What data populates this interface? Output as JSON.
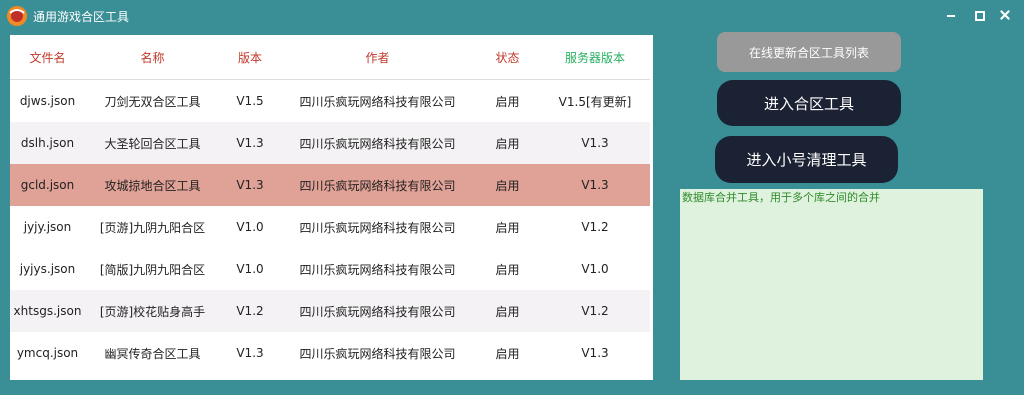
{
  "window": {
    "title": "通用游戏合区工具"
  },
  "table": {
    "headers": [
      "文件名",
      "名称",
      "版本",
      "作者",
      "状态",
      "服务器版本"
    ],
    "rows": [
      [
        "djws.json",
        "刀剑无双合区工具",
        "V1.5",
        "四川乐疯玩网络科技有限公司",
        "启用",
        "V1.5[有更新]"
      ],
      [
        "dslh.json",
        "大圣轮回合区工具",
        "V1.3",
        "四川乐疯玩网络科技有限公司",
        "启用",
        "V1.3"
      ],
      [
        "gcld.json",
        "攻城掠地合区工具",
        "V1.3",
        "四川乐疯玩网络科技有限公司",
        "启用",
        "V1.3"
      ],
      [
        "jyjy.json",
        "[页游]九阴九阳合区",
        "V1.0",
        "四川乐疯玩网络科技有限公司",
        "启用",
        "V1.2"
      ],
      [
        "jyjys.json",
        "[简版]九阴九阳合区",
        "V1.0",
        "四川乐疯玩网络科技有限公司",
        "启用",
        "V1.0"
      ],
      [
        "xhtsgs.json",
        "[页游]校花贴身高手",
        "V1.2",
        "四川乐疯玩网络科技有限公司",
        "启用",
        "V1.2"
      ],
      [
        "ymcq.json",
        "幽冥传奇合区工具",
        "V1.3",
        "四川乐疯玩网络科技有限公司",
        "启用",
        "V1.3"
      ]
    ],
    "selected_row": 2
  },
  "buttons": {
    "update_list": "在线更新合区工具列表",
    "enter_merge": "进入合区工具",
    "enter_cleanup": "进入小号清理工具"
  },
  "description": "数据库合并工具，用于多个库之间的合并",
  "icons": {
    "app_logo": "app-logo-icon",
    "minimize": "minimize-icon",
    "maximize": "maximize-icon",
    "close": "close-icon"
  },
  "colors": {
    "background": "#3a8e96",
    "header_text": "#c0392b",
    "server_header_text": "#27ae60",
    "selected_row": "#e0a197",
    "dark_button": "#1b2233",
    "update_button": "#999999",
    "description_bg": "#dff2de",
    "description_text": "#2f8a2a"
  }
}
